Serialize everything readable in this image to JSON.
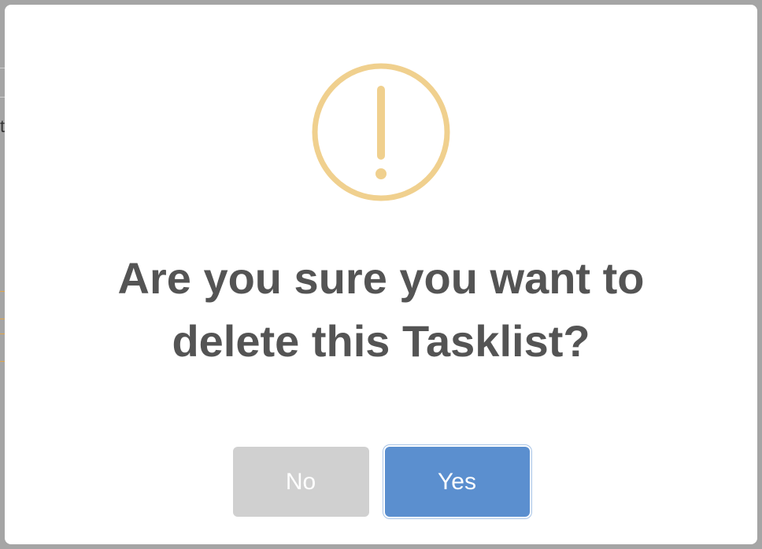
{
  "dialog": {
    "icon": "warning-exclamation-icon",
    "title": "Are you sure you want to delete this Tasklist?",
    "no_label": "No",
    "yes_label": "Yes"
  },
  "colors": {
    "icon": "#f0d08e",
    "title_text": "#545454",
    "no_button": "#d0d0d0",
    "yes_button": "#5b8fcf",
    "overlay": "#a5a5a5"
  }
}
